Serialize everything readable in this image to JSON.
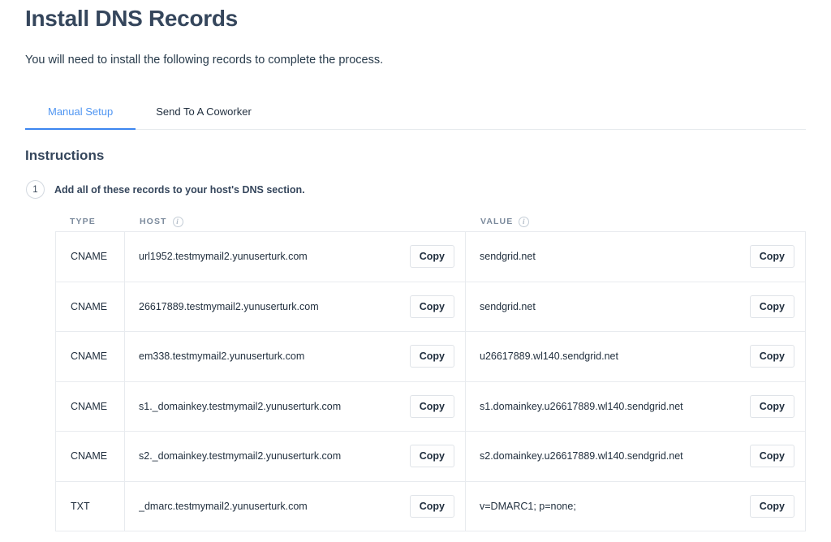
{
  "header": {
    "title": "Install DNS Records",
    "subtitle": "You will need to install the following records to complete the process."
  },
  "tabs": [
    {
      "label": "Manual Setup",
      "active": true
    },
    {
      "label": "Send To A Coworker",
      "active": false
    }
  ],
  "instructions": {
    "section_title": "Instructions",
    "step_number": "1",
    "step_text": "Add all of these records to your host's DNS section."
  },
  "table": {
    "columns": {
      "type": "TYPE",
      "host": "HOST",
      "value": "VALUE"
    },
    "host_info_icon": "info-icon",
    "value_info_icon": "info-icon",
    "copy_label": "Copy",
    "rows": [
      {
        "type": "CNAME",
        "host": "url1952.testmymail2.yunuserturk.com",
        "value": "sendgrid.net"
      },
      {
        "type": "CNAME",
        "host": "26617889.testmymail2.yunuserturk.com",
        "value": "sendgrid.net"
      },
      {
        "type": "CNAME",
        "host": "em338.testmymail2.yunuserturk.com",
        "value": "u26617889.wl140.sendgrid.net"
      },
      {
        "type": "CNAME",
        "host": "s1._domainkey.testmymail2.yunuserturk.com",
        "value": "s1.domainkey.u26617889.wl140.sendgrid.net"
      },
      {
        "type": "CNAME",
        "host": "s2._domainkey.testmymail2.yunuserturk.com",
        "value": "s2.domainkey.u26617889.wl140.sendgrid.net"
      },
      {
        "type": "TXT",
        "host": "_dmarc.testmymail2.yunuserturk.com",
        "value": "v=DMARC1; p=none;"
      }
    ]
  },
  "colors": {
    "heading": "#35465c",
    "accent": "#3c86f0",
    "tab_active_text": "#5096f2",
    "muted": "#7b8a9c",
    "border": "#e8ebef"
  }
}
